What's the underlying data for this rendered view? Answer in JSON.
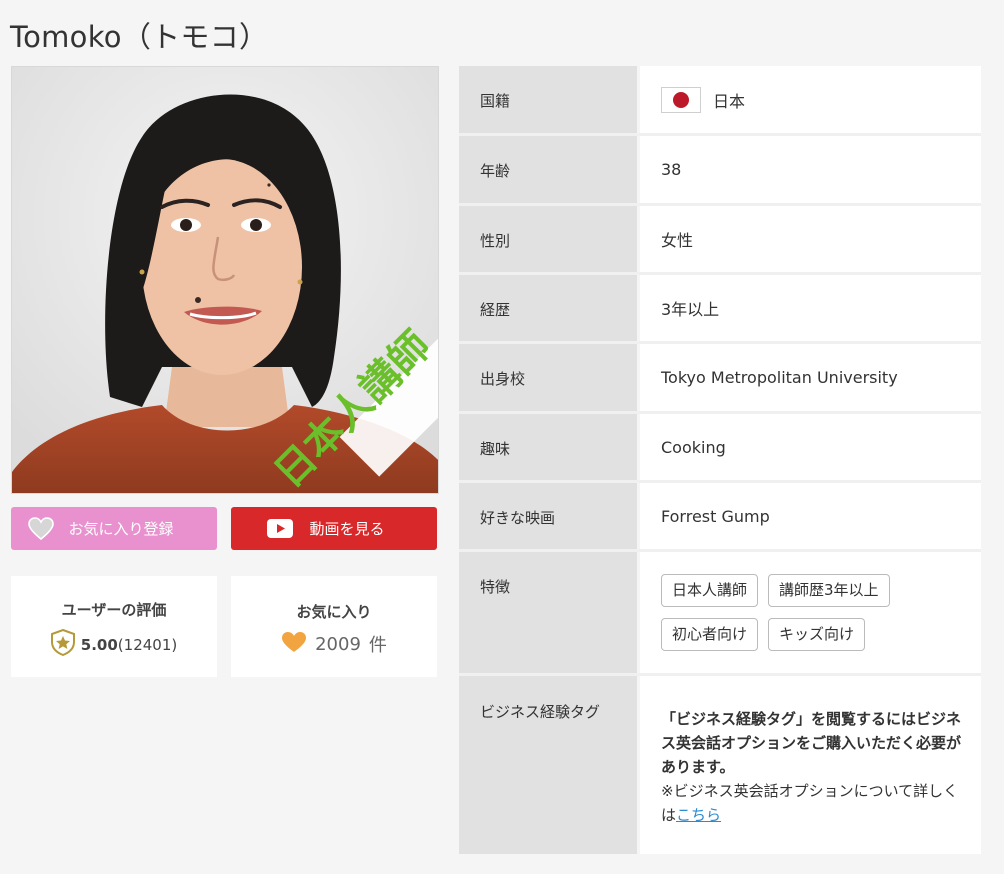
{
  "page": {
    "title": "Tomoko（トモコ）"
  },
  "photo": {
    "badge_text": "日本人講師"
  },
  "buttons": {
    "favorite_label": "お気に入り登録",
    "video_label": "動画を見る"
  },
  "stats": {
    "rating_label": "ユーザーの評価",
    "rating_score": "5.00",
    "rating_count": "(12401)",
    "favorites_label": "お気に入り",
    "favorites_count": "2009",
    "favorites_unit": "件"
  },
  "profile": {
    "nationality_label": "国籍",
    "nationality_value": "日本",
    "age_label": "年齢",
    "age_value": "38",
    "gender_label": "性別",
    "gender_value": "女性",
    "experience_label": "経歴",
    "experience_value": "3年以上",
    "school_label": "出身校",
    "school_value": "Tokyo Metropolitan University",
    "hobby_label": "趣味",
    "hobby_value": "Cooking",
    "movie_label": "好きな映画",
    "movie_value": "Forrest Gump",
    "features_label": "特徴",
    "features_tags": [
      "日本人講師",
      "講師歴3年以上",
      "初心者向け",
      "キッズ向け"
    ],
    "business_label": "ビジネス経験タグ",
    "business_bold": "「ビジネス経験タグ」を閲覧するにはビジネス英会話オプションをご購入いただく必要があります。",
    "business_note": "※ビジネス英会話オプションについて詳しくは",
    "business_link": "こちら"
  },
  "colors": {
    "favorite_button": "#e991cf",
    "video_button": "#d8282a",
    "badge_green": "#6abf2a",
    "link_blue": "#2a8bd2",
    "label_bg": "#e1e1e1"
  },
  "icons": {
    "favorite": "heart-icon",
    "video": "youtube-play-icon",
    "rating": "star-shield-icon",
    "favorites_count": "heart-icon",
    "flag": "japan-flag-icon"
  }
}
